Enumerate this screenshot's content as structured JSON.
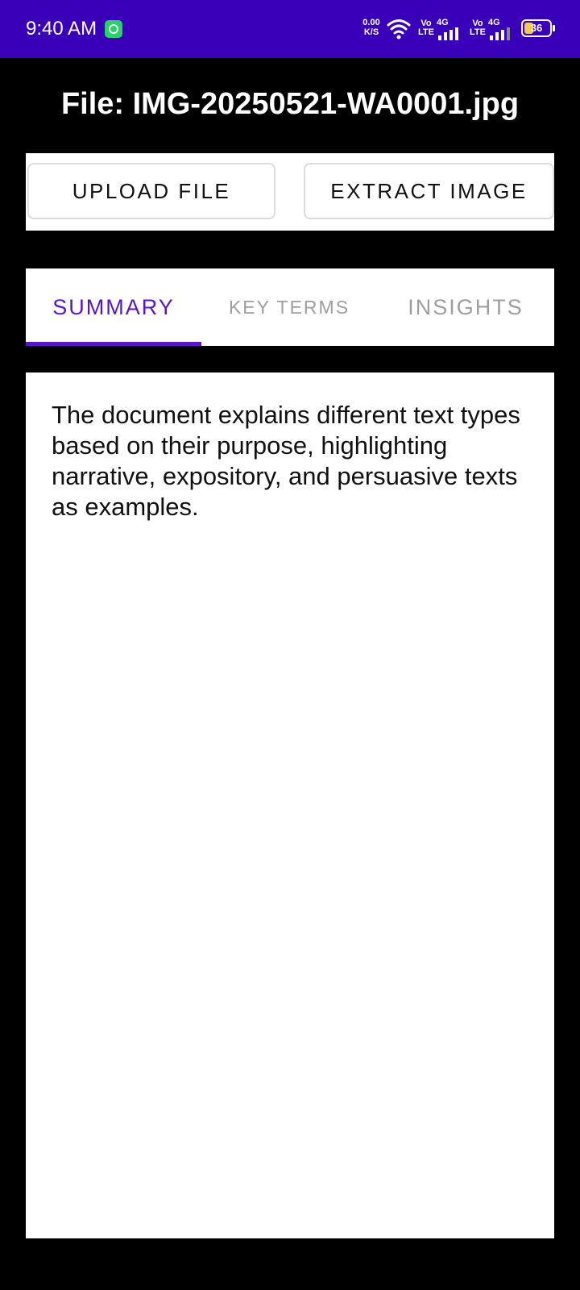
{
  "status_bar": {
    "time": "9:40 AM",
    "net_speed_value": "0.00",
    "net_speed_unit": "K/S",
    "sim1_volte": "Vo LTE",
    "sim1_gen": "4G",
    "sim2_volte": "Vo LTE",
    "sim2_gen": "4G",
    "battery_level": "36",
    "icons": [
      "whatsapp-icon",
      "wifi-icon",
      "signal-icon",
      "battery-icon"
    ],
    "background": "#3a00b9"
  },
  "header": {
    "file_title": "File: IMG-20250521-WA0001.jpg"
  },
  "actions": {
    "upload_label": "UPLOAD FILE",
    "extract_label": "EXTRACT IMAGE"
  },
  "tabs": [
    {
      "label": "SUMMARY",
      "selected": true
    },
    {
      "label": "KEY TERMS",
      "selected": false
    },
    {
      "label": "INSIGHTS",
      "selected": false
    }
  ],
  "accent_color": "#5b14c7",
  "content": {
    "summary": "The document explains different text types based on their purpose, highlighting narrative, expository, and persuasive texts as examples."
  }
}
